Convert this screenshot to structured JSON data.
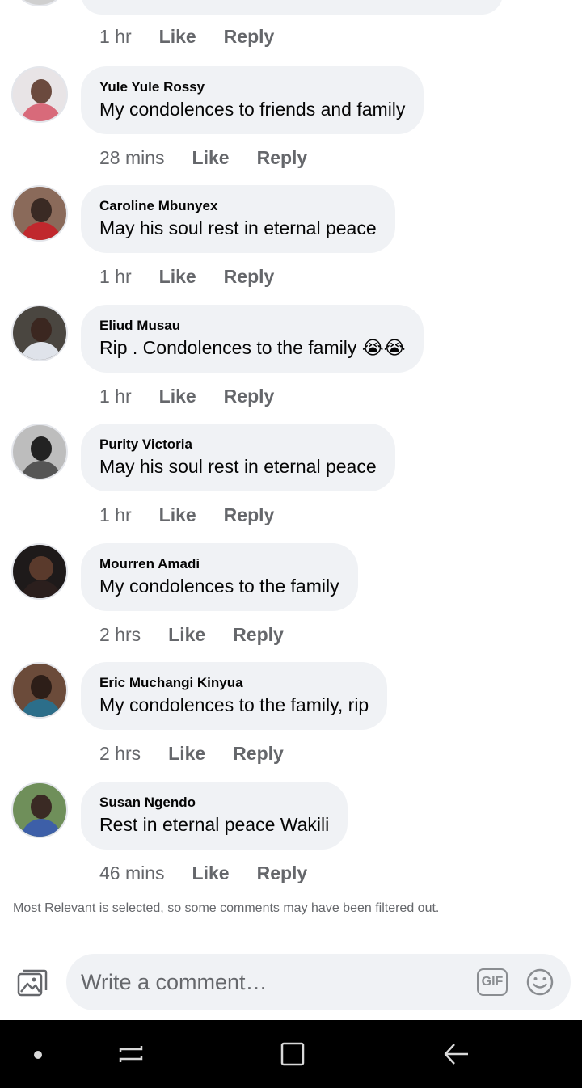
{
  "comments": [
    {
      "name": "",
      "text": "",
      "time": "1 hr",
      "like": "Like",
      "reply": "Reply"
    },
    {
      "name": "Yule Yule Rossy",
      "text": "My condolences to friends and family",
      "time": "28 mins",
      "like": "Like",
      "reply": "Reply"
    },
    {
      "name": "Caroline Mbunyex",
      "text": "May his soul rest in eternal peace",
      "time": "1 hr",
      "like": "Like",
      "reply": "Reply"
    },
    {
      "name": "Eliud Musau",
      "text": "Rip . Condolences to the family 😭😭",
      "time": "1 hr",
      "like": "Like",
      "reply": "Reply"
    },
    {
      "name": "Purity Victoria",
      "text": "May his soul rest in eternal peace",
      "time": "1 hr",
      "like": "Like",
      "reply": "Reply"
    },
    {
      "name": "Mourren Amadi",
      "text": "My condolences to the family",
      "time": "2 hrs",
      "like": "Like",
      "reply": "Reply"
    },
    {
      "name": "Eric Muchangi Kinyua",
      "text": "My condolences to the family, rip",
      "time": "2 hrs",
      "like": "Like",
      "reply": "Reply"
    },
    {
      "name": "Susan Ngendo",
      "text": "Rest in eternal peace Wakili",
      "time": "46 mins",
      "like": "Like",
      "reply": "Reply"
    }
  ],
  "filter_note": "Most Relevant is selected, so some comments may have been filtered out.",
  "composer": {
    "placeholder": "Write a comment…",
    "gif_label": "GIF",
    "photo_icon": "photo-icon",
    "emoji_icon": "smiley-icon"
  },
  "navbar": {
    "recents_icon": "recents-icon",
    "home_icon": "home-icon",
    "back_icon": "back-icon"
  },
  "colors": {
    "bubble": "#f0f2f5",
    "secondary_text": "#65676b",
    "primary_text": "#050505",
    "navbar": "#000000"
  }
}
